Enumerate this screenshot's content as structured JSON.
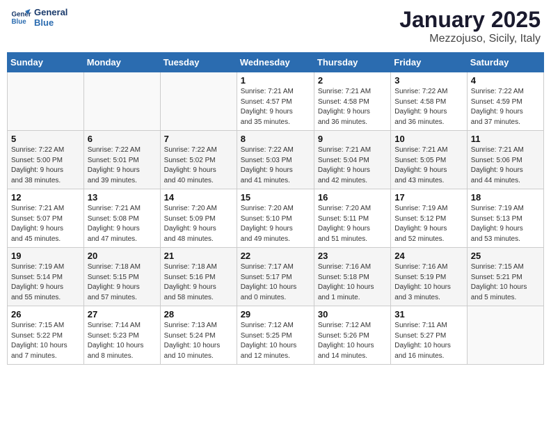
{
  "header": {
    "logo_line1": "General",
    "logo_line2": "Blue",
    "month_year": "January 2025",
    "location": "Mezzojuso, Sicily, Italy"
  },
  "days_of_week": [
    "Sunday",
    "Monday",
    "Tuesday",
    "Wednesday",
    "Thursday",
    "Friday",
    "Saturday"
  ],
  "weeks": [
    [
      {
        "day": "",
        "info": ""
      },
      {
        "day": "",
        "info": ""
      },
      {
        "day": "",
        "info": ""
      },
      {
        "day": "1",
        "info": "Sunrise: 7:21 AM\nSunset: 4:57 PM\nDaylight: 9 hours\nand 35 minutes."
      },
      {
        "day": "2",
        "info": "Sunrise: 7:21 AM\nSunset: 4:58 PM\nDaylight: 9 hours\nand 36 minutes."
      },
      {
        "day": "3",
        "info": "Sunrise: 7:22 AM\nSunset: 4:58 PM\nDaylight: 9 hours\nand 36 minutes."
      },
      {
        "day": "4",
        "info": "Sunrise: 7:22 AM\nSunset: 4:59 PM\nDaylight: 9 hours\nand 37 minutes."
      }
    ],
    [
      {
        "day": "5",
        "info": "Sunrise: 7:22 AM\nSunset: 5:00 PM\nDaylight: 9 hours\nand 38 minutes."
      },
      {
        "day": "6",
        "info": "Sunrise: 7:22 AM\nSunset: 5:01 PM\nDaylight: 9 hours\nand 39 minutes."
      },
      {
        "day": "7",
        "info": "Sunrise: 7:22 AM\nSunset: 5:02 PM\nDaylight: 9 hours\nand 40 minutes."
      },
      {
        "day": "8",
        "info": "Sunrise: 7:22 AM\nSunset: 5:03 PM\nDaylight: 9 hours\nand 41 minutes."
      },
      {
        "day": "9",
        "info": "Sunrise: 7:21 AM\nSunset: 5:04 PM\nDaylight: 9 hours\nand 42 minutes."
      },
      {
        "day": "10",
        "info": "Sunrise: 7:21 AM\nSunset: 5:05 PM\nDaylight: 9 hours\nand 43 minutes."
      },
      {
        "day": "11",
        "info": "Sunrise: 7:21 AM\nSunset: 5:06 PM\nDaylight: 9 hours\nand 44 minutes."
      }
    ],
    [
      {
        "day": "12",
        "info": "Sunrise: 7:21 AM\nSunset: 5:07 PM\nDaylight: 9 hours\nand 45 minutes."
      },
      {
        "day": "13",
        "info": "Sunrise: 7:21 AM\nSunset: 5:08 PM\nDaylight: 9 hours\nand 47 minutes."
      },
      {
        "day": "14",
        "info": "Sunrise: 7:20 AM\nSunset: 5:09 PM\nDaylight: 9 hours\nand 48 minutes."
      },
      {
        "day": "15",
        "info": "Sunrise: 7:20 AM\nSunset: 5:10 PM\nDaylight: 9 hours\nand 49 minutes."
      },
      {
        "day": "16",
        "info": "Sunrise: 7:20 AM\nSunset: 5:11 PM\nDaylight: 9 hours\nand 51 minutes."
      },
      {
        "day": "17",
        "info": "Sunrise: 7:19 AM\nSunset: 5:12 PM\nDaylight: 9 hours\nand 52 minutes."
      },
      {
        "day": "18",
        "info": "Sunrise: 7:19 AM\nSunset: 5:13 PM\nDaylight: 9 hours\nand 53 minutes."
      }
    ],
    [
      {
        "day": "19",
        "info": "Sunrise: 7:19 AM\nSunset: 5:14 PM\nDaylight: 9 hours\nand 55 minutes."
      },
      {
        "day": "20",
        "info": "Sunrise: 7:18 AM\nSunset: 5:15 PM\nDaylight: 9 hours\nand 57 minutes."
      },
      {
        "day": "21",
        "info": "Sunrise: 7:18 AM\nSunset: 5:16 PM\nDaylight: 9 hours\nand 58 minutes."
      },
      {
        "day": "22",
        "info": "Sunrise: 7:17 AM\nSunset: 5:17 PM\nDaylight: 10 hours\nand 0 minutes."
      },
      {
        "day": "23",
        "info": "Sunrise: 7:16 AM\nSunset: 5:18 PM\nDaylight: 10 hours\nand 1 minute."
      },
      {
        "day": "24",
        "info": "Sunrise: 7:16 AM\nSunset: 5:19 PM\nDaylight: 10 hours\nand 3 minutes."
      },
      {
        "day": "25",
        "info": "Sunrise: 7:15 AM\nSunset: 5:21 PM\nDaylight: 10 hours\nand 5 minutes."
      }
    ],
    [
      {
        "day": "26",
        "info": "Sunrise: 7:15 AM\nSunset: 5:22 PM\nDaylight: 10 hours\nand 7 minutes."
      },
      {
        "day": "27",
        "info": "Sunrise: 7:14 AM\nSunset: 5:23 PM\nDaylight: 10 hours\nand 8 minutes."
      },
      {
        "day": "28",
        "info": "Sunrise: 7:13 AM\nSunset: 5:24 PM\nDaylight: 10 hours\nand 10 minutes."
      },
      {
        "day": "29",
        "info": "Sunrise: 7:12 AM\nSunset: 5:25 PM\nDaylight: 10 hours\nand 12 minutes."
      },
      {
        "day": "30",
        "info": "Sunrise: 7:12 AM\nSunset: 5:26 PM\nDaylight: 10 hours\nand 14 minutes."
      },
      {
        "day": "31",
        "info": "Sunrise: 7:11 AM\nSunset: 5:27 PM\nDaylight: 10 hours\nand 16 minutes."
      },
      {
        "day": "",
        "info": ""
      }
    ]
  ]
}
